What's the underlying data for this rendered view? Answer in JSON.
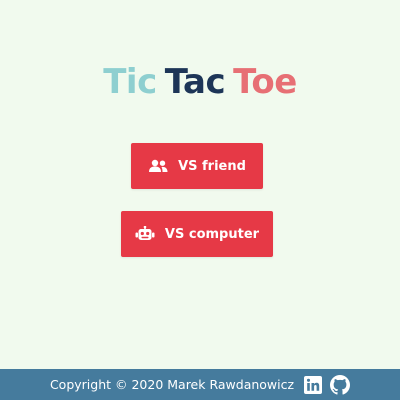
{
  "title": {
    "word1": "Tic",
    "word2": "Tac",
    "word3": "Toe"
  },
  "menu": {
    "vs_friend_label": "VS friend",
    "vs_friend_icon": "users-icon",
    "vs_computer_label": "VS computer",
    "vs_computer_icon": "robot-icon"
  },
  "footer": {
    "copyright": "Copyright © 2020 Marek Rawdanowicz",
    "links": [
      "linkedin-icon",
      "github-icon"
    ]
  },
  "colors": {
    "background": "#f1faee",
    "button": "#e63946",
    "footer": "#457b9d",
    "title_tic": "#8ecfd0",
    "title_tac": "#1d3557",
    "title_toe": "#e76f74"
  }
}
